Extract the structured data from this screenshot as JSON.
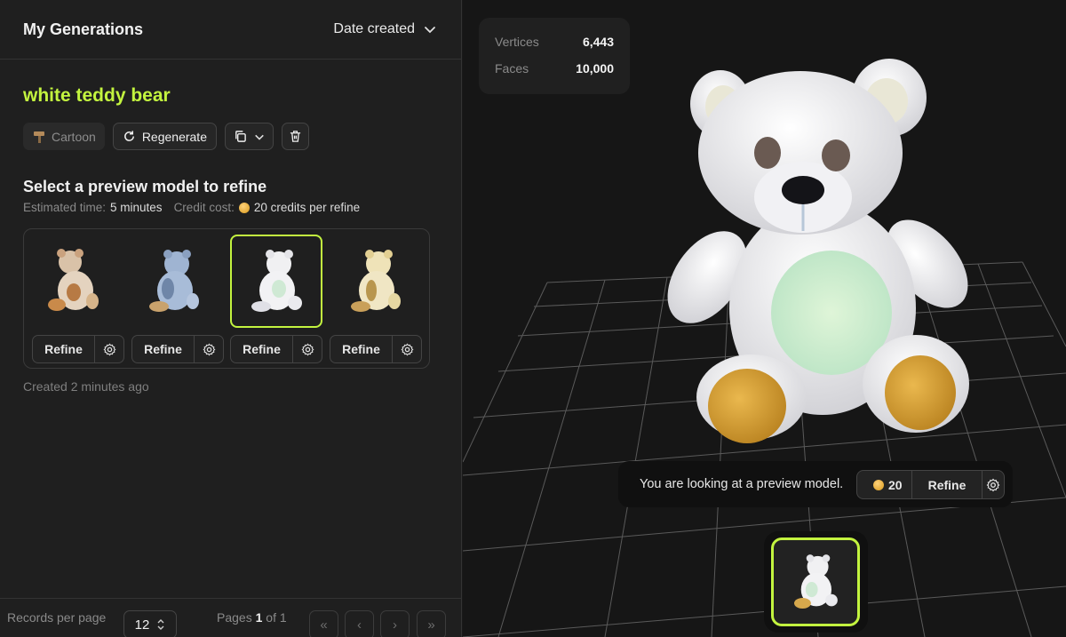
{
  "left": {
    "title": "My Generations",
    "sort_label": "Date created",
    "generation_title": "white teddy bear",
    "style_tag": "Cartoon",
    "regenerate_label": "Regenerate",
    "section_title": "Select a preview model to refine",
    "estimated_time_label": "Estimated time:",
    "estimated_time_value": "5 minutes",
    "credit_cost_label": "Credit cost:",
    "credit_cost_value": "20 credits per refine",
    "previews": [
      {
        "refine_label": "Refine",
        "selected": false,
        "tint": "#d9b89a"
      },
      {
        "refine_label": "Refine",
        "selected": false,
        "tint": "#8ea6c8"
      },
      {
        "refine_label": "Refine",
        "selected": true,
        "tint": "#e8e8ee"
      },
      {
        "refine_label": "Refine",
        "selected": false,
        "tint": "#e8d59a"
      }
    ],
    "created_text": "Created 2 minutes ago",
    "footer": {
      "records_per_page_label": "Records per page",
      "records_per_page_value": "12",
      "pages_prefix": "Pages",
      "current_page": "1",
      "pages_suffix": "of 1",
      "first_icon": "«",
      "prev_icon": "‹",
      "next_icon": "›",
      "last_icon": "»"
    }
  },
  "viewport": {
    "stats": [
      {
        "label": "Vertices",
        "value": "6,443"
      },
      {
        "label": "Faces",
        "value": "10,000"
      }
    ],
    "preview_message": "You are looking at a preview model.",
    "credit_amount": "20",
    "refine_label": "Refine"
  },
  "colors": {
    "accent": "#c3f43f",
    "coin": "#e0a52a"
  }
}
